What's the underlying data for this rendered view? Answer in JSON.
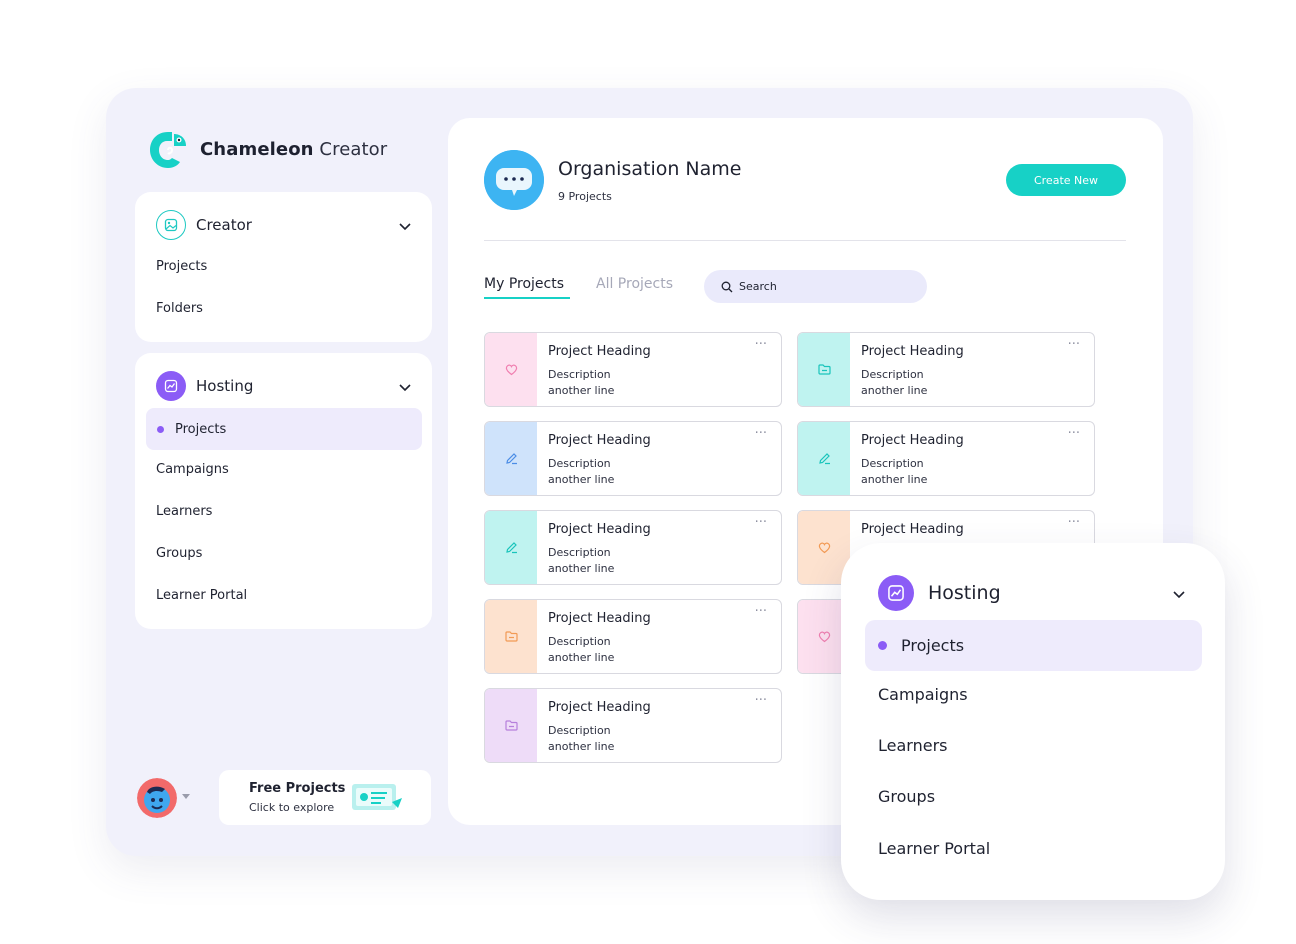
{
  "brand": {
    "name_bold": "Chameleon",
    "name_light": "Creator",
    "logo_icon": "chameleon-logo-icon",
    "accent": "#17d1c6"
  },
  "sidebar": {
    "creator": {
      "label": "Creator",
      "icon": "image-icon",
      "items": [
        "Projects",
        "Folders"
      ]
    },
    "hosting": {
      "label": "Hosting",
      "icon": "chart-icon",
      "active_item": "Projects",
      "items": [
        "Projects",
        "Campaigns",
        "Learners",
        "Groups",
        "Learner Portal"
      ]
    },
    "promo": {
      "title": "Free Projects",
      "subtitle": "Click to explore"
    }
  },
  "org": {
    "name": "Organisation Name",
    "count": "9 Projects",
    "icon": "chat-bubble-icon"
  },
  "toolbar": {
    "create_label": "Create New",
    "search_placeholder": "Search"
  },
  "tabs": [
    {
      "label": "My Projects",
      "active": true
    },
    {
      "label": "All Projects",
      "active": false
    }
  ],
  "projects": [
    {
      "title": "Project Heading",
      "desc1": "Description",
      "desc2": "another line",
      "color": "#fde0ef",
      "icon": "heart-icon",
      "icon_color": "#f07fb0"
    },
    {
      "title": "Project Heading",
      "desc1": "Description",
      "desc2": "another line",
      "color": "#bff3f0",
      "icon": "folder-icon",
      "icon_color": "#19c4bb"
    },
    {
      "title": "Project Heading",
      "desc1": "Description",
      "desc2": "another line",
      "color": "#cfe3fb",
      "icon": "pencil-icon",
      "icon_color": "#4b8de6"
    },
    {
      "title": "Project Heading",
      "desc1": "Description",
      "desc2": "another line",
      "color": "#bff3f0",
      "icon": "pencil-icon",
      "icon_color": "#19c4bb"
    },
    {
      "title": "Project Heading",
      "desc1": "Description",
      "desc2": "another line",
      "color": "#bff3f0",
      "icon": "pencil-icon",
      "icon_color": "#19c4bb"
    },
    {
      "title": "Project Heading",
      "desc1": "",
      "desc2": "",
      "color": "#fde2cf",
      "icon": "heart-icon",
      "icon_color": "#f29a55"
    },
    {
      "title": "Project Heading",
      "desc1": "Description",
      "desc2": "another line",
      "color": "#fde2cf",
      "icon": "folder-icon",
      "icon_color": "#f29a55"
    },
    {
      "title": "",
      "desc1": "",
      "desc2": "",
      "color": "#fde0ef",
      "icon": "heart-icon",
      "icon_color": "#f07fb0"
    },
    {
      "title": "Project Heading",
      "desc1": "Description",
      "desc2": "another line",
      "color": "#eedcf8",
      "icon": "folder-icon",
      "icon_color": "#b67fdc"
    }
  ],
  "zoom_panel": {
    "label": "Hosting",
    "active_item": "Projects",
    "items": [
      "Projects",
      "Campaigns",
      "Learners",
      "Groups",
      "Learner Portal"
    ]
  },
  "colors": {
    "accent": "#17d1c6",
    "purple": "#8b5cf6",
    "background": "#f1f1fb"
  }
}
